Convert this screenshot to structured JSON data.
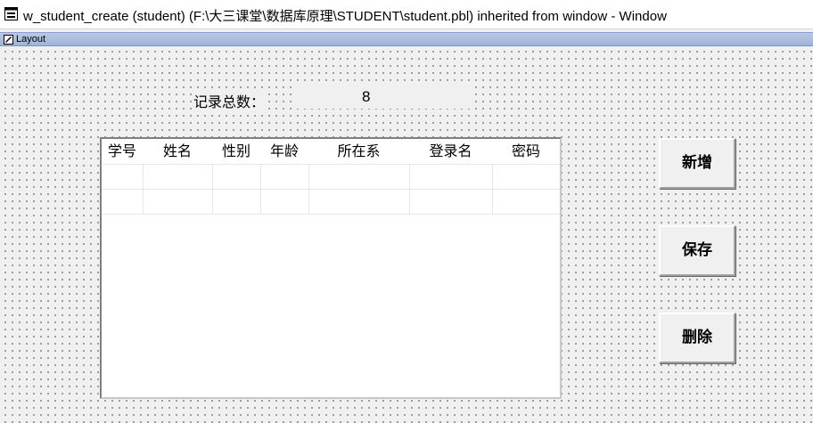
{
  "window": {
    "title": "w_student_create (student) (F:\\大三课堂\\数据库原理\\STUDENT\\student.pbl) inherited from window - Window",
    "layout_tab": "Layout"
  },
  "form": {
    "count_label": "记录总数：",
    "count_value": "8"
  },
  "grid": {
    "columns": [
      "学号",
      "姓名",
      "性别",
      "年龄",
      "所在系",
      "登录名",
      "密码"
    ]
  },
  "buttons": {
    "add": "新增",
    "save": "保存",
    "delete": "删除"
  }
}
